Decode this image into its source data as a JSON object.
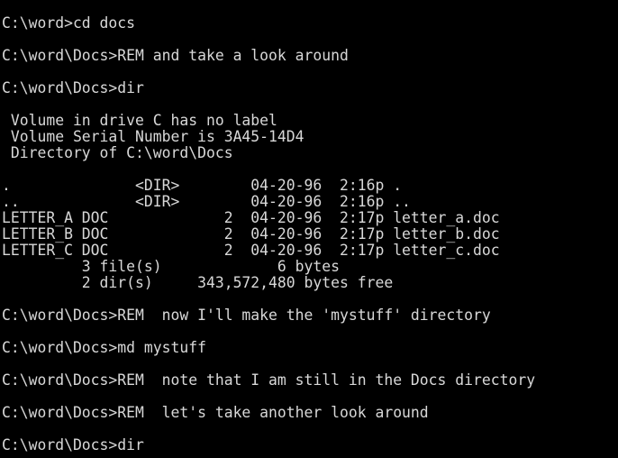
{
  "console": {
    "text_color": "#d8d8d8",
    "background_color": "#000000",
    "lines": [
      "C:\\word>cd docs",
      "",
      "C:\\word\\Docs>REM and take a look around",
      "",
      "C:\\word\\Docs>dir",
      "",
      " Volume in drive C has no label",
      " Volume Serial Number is 3A45-14D4",
      " Directory of C:\\word\\Docs",
      "",
      ".              <DIR>        04-20-96  2:16p .",
      "..             <DIR>        04-20-96  2:16p ..",
      "LETTER_A DOC             2  04-20-96  2:17p letter_a.doc",
      "LETTER_B DOC             2  04-20-96  2:17p letter_b.doc",
      "LETTER_C DOC             2  04-20-96  2:17p letter_c.doc",
      "         3 file(s)             6 bytes",
      "         2 dir(s)     343,572,480 bytes free",
      "",
      "C:\\word\\Docs>REM  now I'll make the 'mystuff' directory",
      "",
      "C:\\word\\Docs>md mystuff",
      "",
      "C:\\word\\Docs>REM  note that I am still in the Docs directory",
      "",
      "C:\\word\\Docs>REM  let's take another look around",
      "",
      "C:\\word\\Docs>dir"
    ]
  }
}
